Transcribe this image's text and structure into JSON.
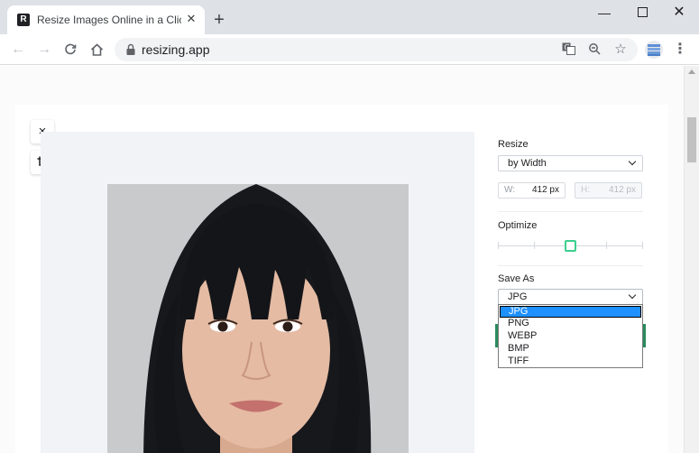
{
  "browser": {
    "tab_title": "Resize Images Online in a Click",
    "tab_favicon_letter": "R",
    "url": "resizing.app",
    "icons": [
      "favicon-icon",
      "close-icon",
      "plus-icon",
      "minimize-icon",
      "maximize-icon",
      "close-window-icon",
      "back-arrow-icon",
      "forward-arrow-icon",
      "reload-icon",
      "home-icon",
      "lock-icon",
      "translate-icon",
      "zoom-icon",
      "star-icon",
      "extension-icon",
      "menu-icon"
    ]
  },
  "editor": {
    "tools": [
      {
        "name": "close",
        "icon": "×"
      },
      {
        "name": "crop",
        "icon": "⌗"
      }
    ]
  },
  "settings": {
    "resize_label": "Resize",
    "resize_mode": "by Width",
    "width_letter": "W:",
    "width_value": "412 px",
    "height_letter": "H:",
    "height_value": "412 px",
    "optimize_label": "Optimize",
    "optimize_level": 0.5,
    "save_as_label": "Save As",
    "save_as_value": "JPG",
    "format_options": [
      "JPG",
      "PNG",
      "WEBP",
      "BMP",
      "TIFF"
    ],
    "selected_option_index": 0
  },
  "colors": {
    "accent_green": "#3ccf8e",
    "dropdown_highlight": "#1e90ff"
  }
}
